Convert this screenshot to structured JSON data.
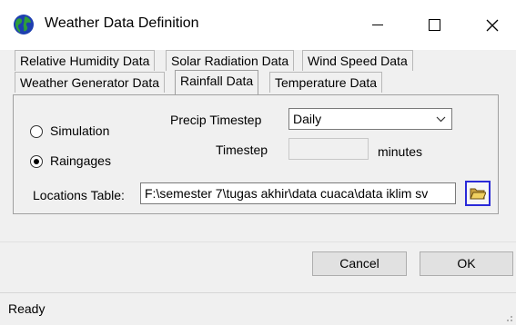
{
  "window": {
    "title": "Weather Data Definition"
  },
  "tabs_row1": [
    {
      "label": "Relative Humidity Data"
    },
    {
      "label": "Solar Radiation Data"
    },
    {
      "label": "Wind Speed Data"
    }
  ],
  "tabs_row2": [
    {
      "label": "Weather Generator Data"
    },
    {
      "label": "Rainfall Data",
      "active": true
    },
    {
      "label": "Temperature Data"
    }
  ],
  "source": {
    "simulation_label": "Simulation",
    "raingages_label": "Raingages",
    "selected": "Raingages"
  },
  "precip_timestep": {
    "label": "Precip Timestep",
    "value": "Daily"
  },
  "timestep": {
    "label": "Timestep",
    "value": "",
    "unit": "minutes"
  },
  "locations": {
    "label": "Locations Table:",
    "value": "F:\\semester 7\\tugas akhir\\data cuaca\\data iklim sv"
  },
  "buttons": {
    "cancel": "Cancel",
    "ok": "OK"
  },
  "status": {
    "text": "Ready"
  }
}
